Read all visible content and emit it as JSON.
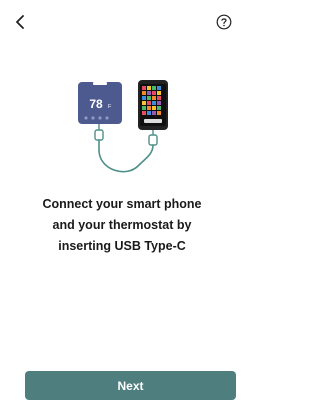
{
  "header": {
    "back_icon": "chevron-left-icon",
    "help_icon": "question-circle-icon"
  },
  "illustration": {
    "thermostat_temperature": "78",
    "thermostat_unit": "F",
    "thermostat_color": "#4d5a8f",
    "cable_color": "#4f8f8a"
  },
  "instruction": {
    "lines": [
      "Connect your smart phone",
      "and your thermostat by",
      "inserting USB Type-C"
    ]
  },
  "footer": {
    "next_label": "Next",
    "button_color": "#4f7e7e"
  }
}
